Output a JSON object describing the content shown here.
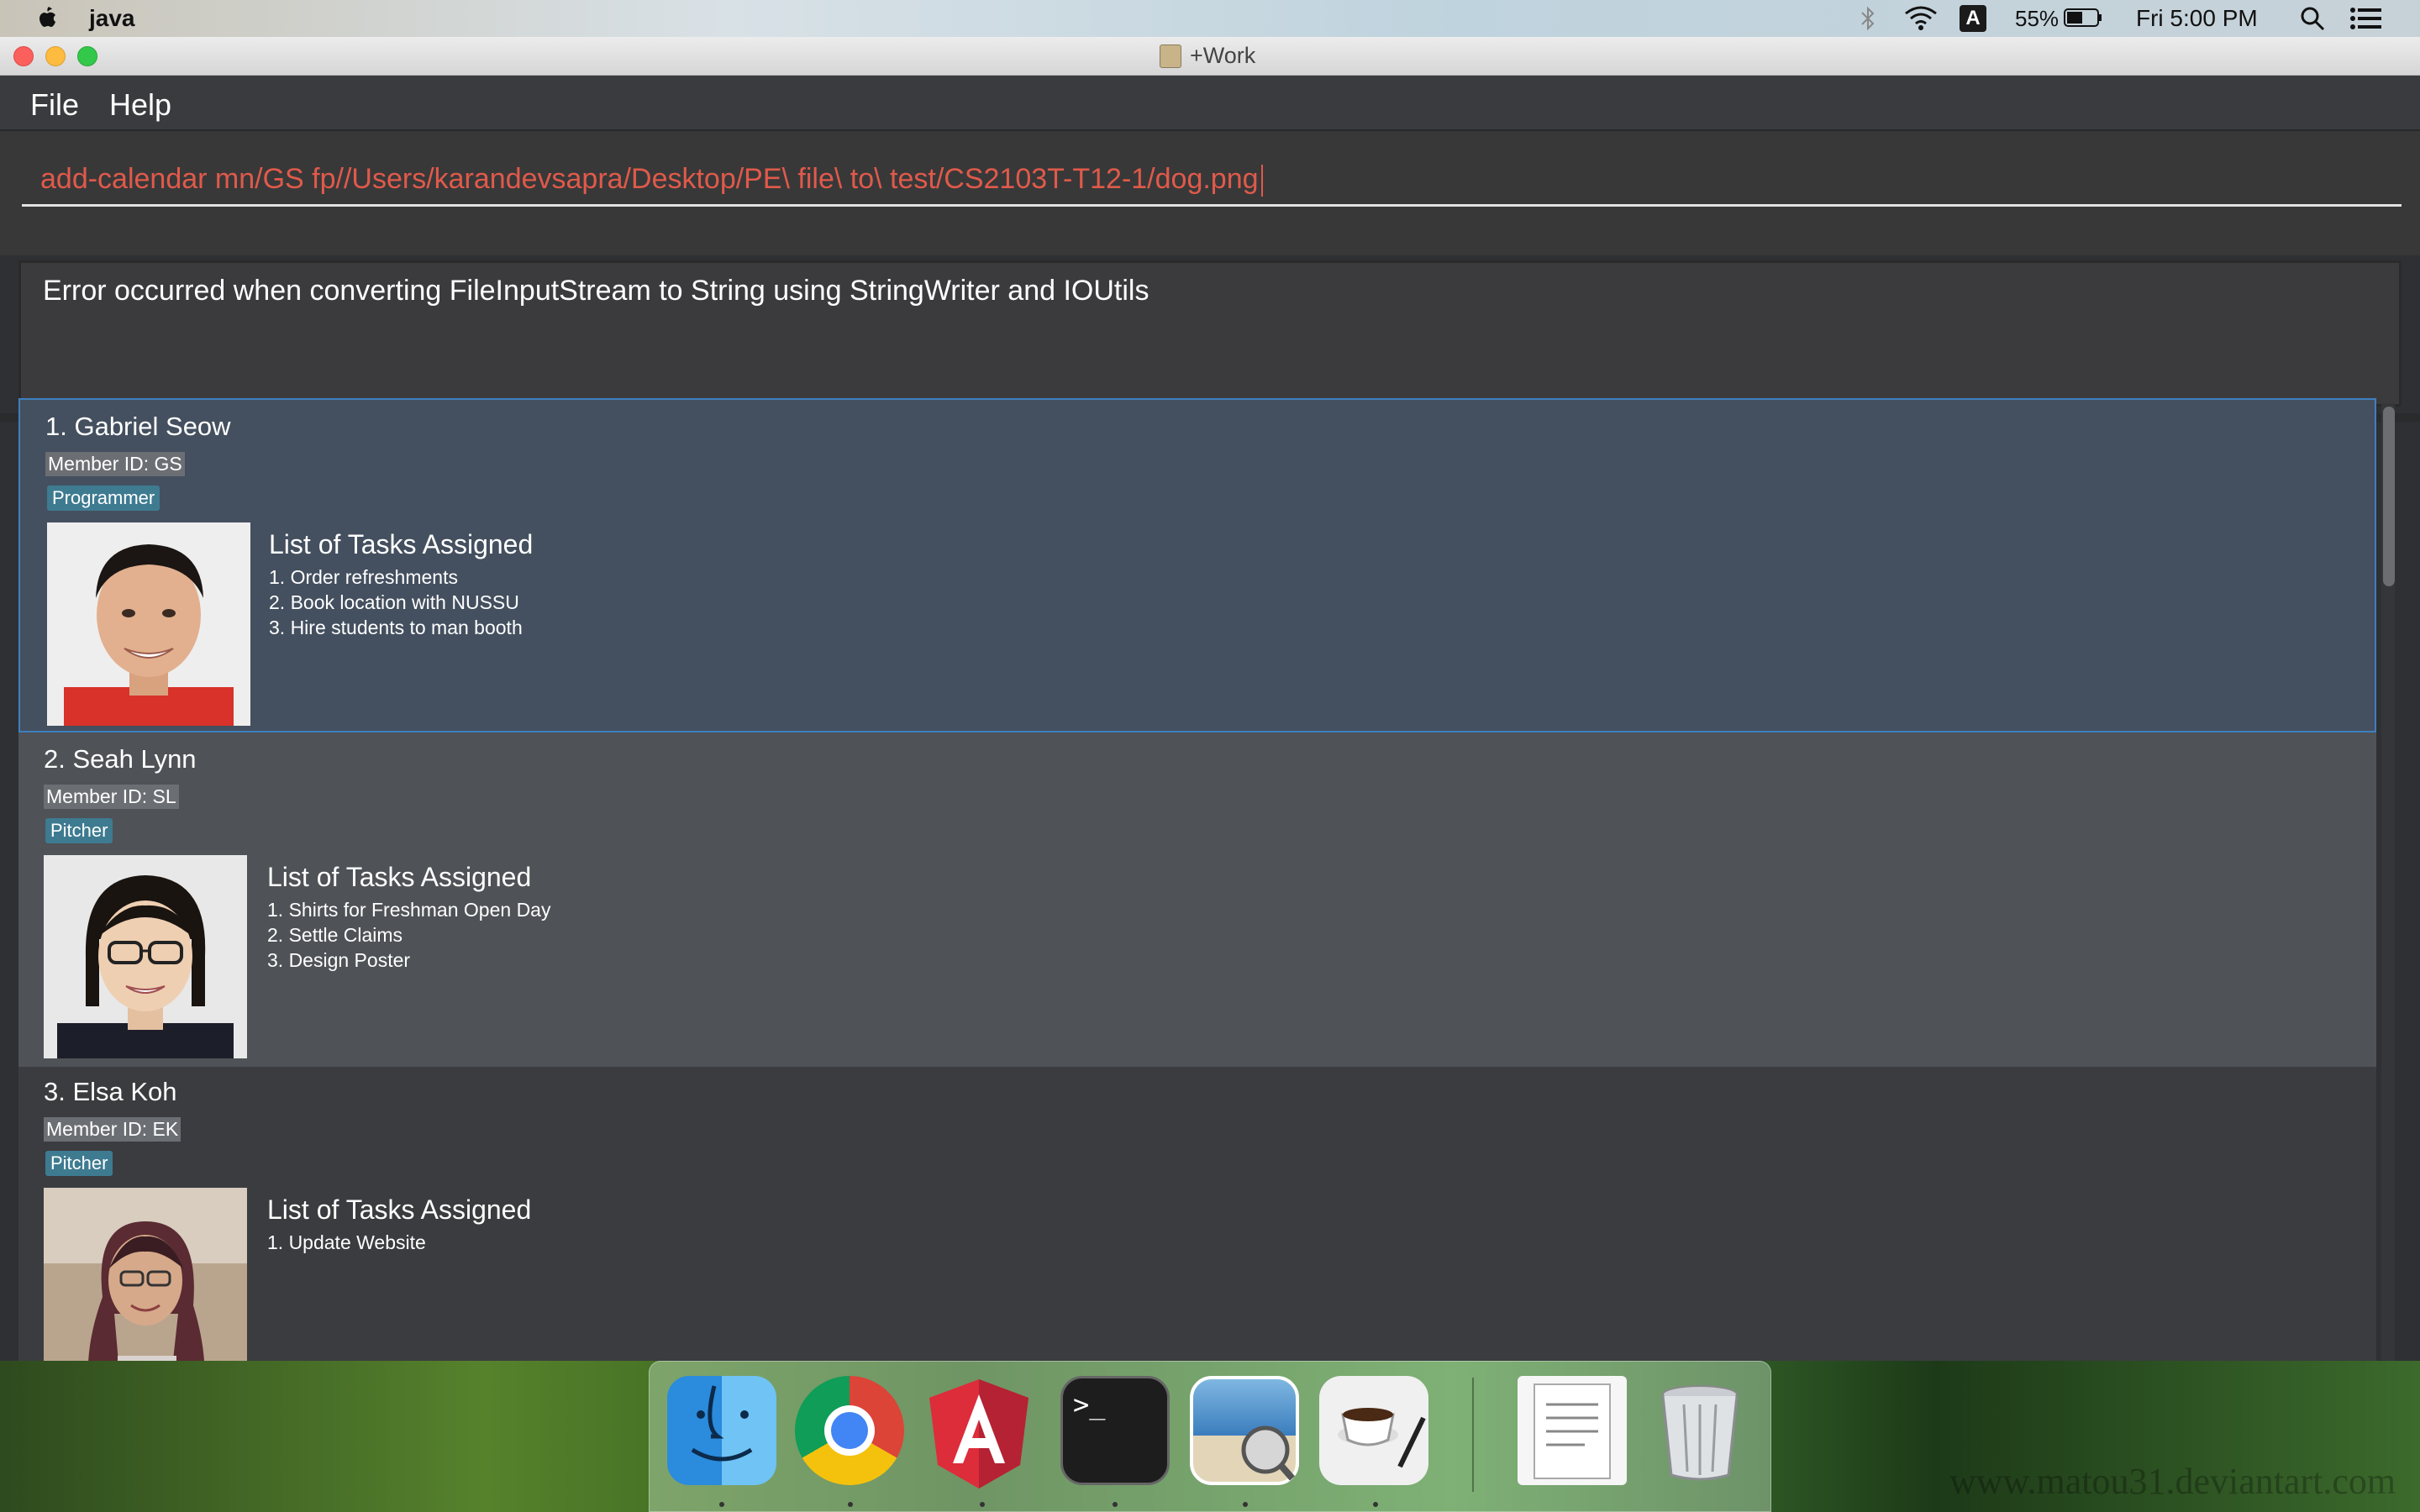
{
  "menubar": {
    "app_name": "java",
    "input_source": "A",
    "battery_percent": "55%",
    "clock": "Fri 5:00 PM"
  },
  "window": {
    "title": "+Work"
  },
  "app_menu": {
    "file": "File",
    "help": "Help"
  },
  "command": {
    "value": "add-calendar mn/GS fp//Users/karandevsapra/Desktop/PE\\ file\\ to\\ test/CS2103T-T12-1/dog.png"
  },
  "result": {
    "message": "Error occurred when converting FileInputStream to String using StringWriter and IOUtils"
  },
  "members": [
    {
      "index_name": "1.  Gabriel Seow",
      "member_id": "Member ID: GS",
      "role": "Programmer",
      "tasks_title": "List of Tasks Assigned",
      "tasks": [
        "1. Order refreshments",
        "2. Book location with NUSSU",
        "3. Hire students to man booth"
      ]
    },
    {
      "index_name": "2.  Seah Lynn",
      "member_id": "Member ID: SL",
      "role": "Pitcher",
      "tasks_title": "List of Tasks Assigned",
      "tasks": [
        "1. Shirts for Freshman Open Day",
        "2. Settle Claims",
        "3. Design Poster"
      ]
    },
    {
      "index_name": "3.  Elsa Koh",
      "member_id": "Member ID: EK",
      "role": "Pitcher",
      "tasks_title": "List of Tasks Assigned",
      "tasks": [
        "1. Update Website"
      ]
    }
  ],
  "dock": {
    "apps": [
      "finder-icon",
      "chrome-icon",
      "angular-icon",
      "terminal-icon",
      "preview-icon",
      "java-icon",
      "documents-icon",
      "trash-icon"
    ]
  },
  "watermark": "www.matou31.deviantart.com",
  "colors": {
    "command_text": "#e05a4a",
    "selected_card": "#44505f",
    "role_tag": "#3e7b91"
  }
}
